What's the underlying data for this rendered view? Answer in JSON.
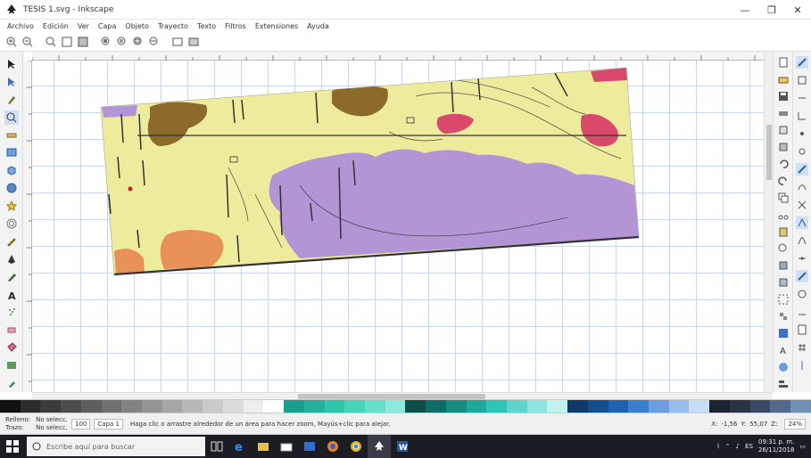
{
  "window": {
    "title": "TESIS 1.svg - Inkscape",
    "controls": {
      "minimize": "—",
      "maximize": "❐",
      "close": "✕"
    }
  },
  "menu": [
    "Archivo",
    "Edición",
    "Ver",
    "Capa",
    "Objeto",
    "Trayecto",
    "Texto",
    "Filtros",
    "Extensiones",
    "Ayuda"
  ],
  "toolbar": {
    "icons": [
      "zoom-in-icon",
      "zoom-out-icon",
      "zoom-1to1-icon",
      "zoom-1to2-icon",
      "zoom-2to1-icon",
      "zoom-selection-icon",
      "zoom-drawing-icon",
      "zoom-page-icon",
      "zoom-page-width-icon",
      "zoom-prev-icon",
      "zoom-next-icon"
    ]
  },
  "left_tools": [
    "selector-icon",
    "node-tool-icon",
    "tweak-tool-icon",
    "zoom-tool-icon",
    "measure-tool-icon",
    "rect-tool-icon",
    "3dbox-tool-icon",
    "ellipse-tool-icon",
    "star-tool-icon",
    "spiral-tool-icon",
    "pencil-tool-icon",
    "pen-tool-icon",
    "calligraphy-tool-icon",
    "text-tool-icon",
    "spray-tool-icon",
    "eraser-tool-icon",
    "bucket-tool-icon",
    "gradient-tool-icon",
    "dropper-tool-icon"
  ],
  "canvas": {
    "map": {
      "colors": {
        "base": "#ecec9c",
        "purple": "#b395d6",
        "brown": "#8b6a2a",
        "red": "#d94a6a",
        "orange": "#e8925a",
        "line": "#333333"
      }
    }
  },
  "palette": [
    "#111111",
    "#2b2b2b",
    "#3c3c3c",
    "#4d4d4d",
    "#5e5e5e",
    "#707070",
    "#828282",
    "#949494",
    "#a6a6a6",
    "#b8b8b8",
    "#cacaca",
    "#dcdcdc",
    "#eeeeee",
    "#ffffff",
    "#1aa08c",
    "#22b39c",
    "#2cc6aa",
    "#44d4b8",
    "#66e0c8",
    "#8aeadb",
    "#0a4f48",
    "#0e6d64",
    "#148c80",
    "#1caa9c",
    "#2ec4b6",
    "#5cd6cc",
    "#8ee4de",
    "#c0f2ee",
    "#0b3a6b",
    "#134f8f",
    "#1b64b3",
    "#3b7fd0",
    "#6a9ee0",
    "#9abcec",
    "#cadbf6",
    "#1c2230",
    "#2a3244",
    "#3a4a66",
    "#52688c",
    "#7090b4"
  ],
  "status": {
    "fill_label": "Relleno:",
    "stroke_label": "Trazo:",
    "fill_value": "No selecc.",
    "stroke_value": "No selecc.",
    "opacity": "100",
    "layer": "Capa 1",
    "message": "Haga clic o arrastre alrededor de un área para hacer zoom, Mayús+clic para alejar.",
    "x_label": "X:",
    "y_label": "Y:",
    "x_value": "-1,56",
    "y_value": "55,07",
    "zoom_label": "Z:",
    "zoom_value": "24%"
  },
  "taskbar": {
    "search_placeholder": "Escribe aquí para buscar",
    "apps": [
      "task-view-icon",
      "edge-icon",
      "file-explorer-icon",
      "store-icon",
      "photos-icon",
      "firefox-icon",
      "chrome-icon",
      "inkscape-icon",
      "word-icon"
    ],
    "time": "09:31 p. m.",
    "date": "26/11/2018"
  }
}
